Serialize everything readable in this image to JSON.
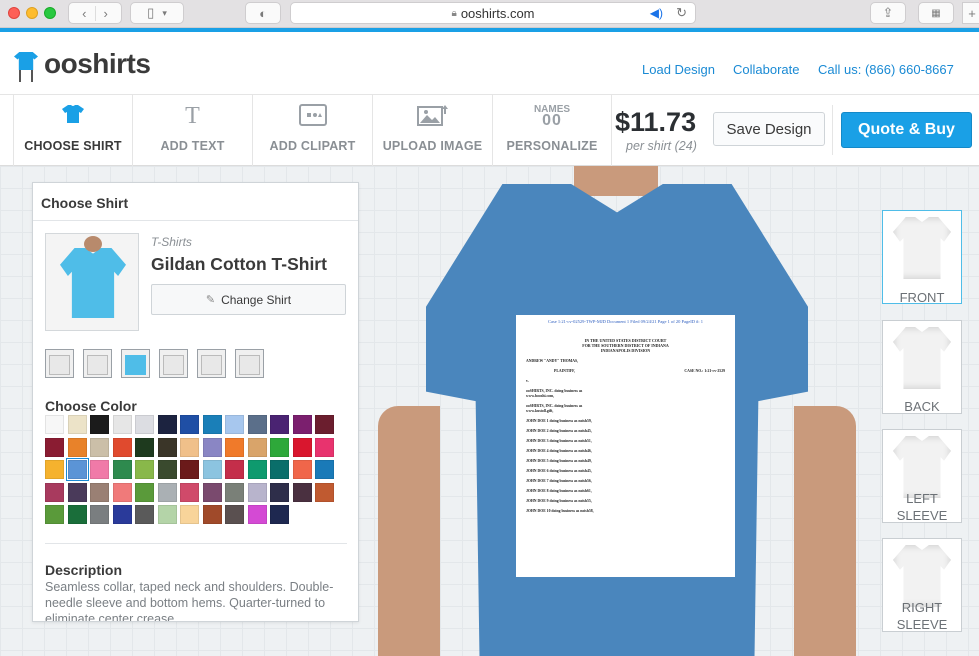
{
  "browser": {
    "url": "ooshirts.com"
  },
  "header": {
    "logo_text": "ooshirts",
    "links": [
      "Load Design",
      "Collaborate",
      "Call us: (866) 660-8667"
    ]
  },
  "toolbar": {
    "tools": [
      {
        "label": "CHOOSE SHIRT",
        "icon": "tshirt-icon"
      },
      {
        "label": "ADD TEXT",
        "icon": "text-icon"
      },
      {
        "label": "ADD CLIPART",
        "icon": "clipart-icon"
      },
      {
        "label": "UPLOAD IMAGE",
        "icon": "upload-image-icon"
      },
      {
        "label": "PERSONALIZE",
        "icon": "names-icon",
        "icon_text_top": "NAMES",
        "icon_text_bottom": "00"
      }
    ],
    "price": "$11.73",
    "per_shirt": "per shirt (24)",
    "save_label": "Save Design",
    "quote_label": "Quote & Buy"
  },
  "panel": {
    "title": "Choose Shirt",
    "category": "T-Shirts",
    "product_name": "Gildan Cotton T-Shirt",
    "change_label": "Change Shirt",
    "choose_color_label": "Choose Color",
    "description_title": "Description",
    "description": "Seamless collar, taped neck and shoulders. Double-needle sleeve and bottom hems. Quarter-turned to eliminate center crease.",
    "colors": [
      "#f7f7f7",
      "#ece3c8",
      "#1b1b1b",
      "#e6e6e6",
      "#dcdde2",
      "#1c2340",
      "#1f4fa5",
      "#1a7fb8",
      "#a7c7ee",
      "#5b6f8a",
      "#4a2372",
      "#7b1f6e",
      "#6b1e2e",
      "#8a1c32",
      "#e8822a",
      "#cbbfa8",
      "#e04a2e",
      "#1e3a1e",
      "#3a3528",
      "#f0c08a",
      "#8a86c4",
      "#f07a2a",
      "#d9a46a",
      "#2ea83a",
      "#d9162e",
      "#e8336e",
      "#f5b22e",
      "#5b94d6",
      "#f07aa8",
      "#2e8a4e",
      "#89b84a",
      "#3a4a2e",
      "#6b1a1a",
      "#8cc4e0",
      "#c42e4a",
      "#0e9a6e",
      "#0a6e6a",
      "#f0664a",
      "#1a7ab8",
      "#a83a5e",
      "#4a3a5a",
      "#9a8074",
      "#f07a7a",
      "#5a9a3a",
      "#aab0b4",
      "#d04a6a",
      "#7a4a6e",
      "#7a8078",
      "#b8b4cc",
      "#2e2e4a",
      "#4a3040",
      "#c05a30",
      "#5a9a3a",
      "#1a6e3a",
      "#7a7e80",
      "#2a3a9a",
      "#5a5a5a",
      "#b4d4a8",
      "#f8d49a",
      "#a04a2a",
      "#5a5050",
      "#d44ad4",
      "#1e2850"
    ],
    "selected_color": "#5b94d6"
  },
  "print_document": {
    "header_line": "Case 1:21-cv-02529-TWP-MJD   Document 1   Filed 09/24/21   Page 1 of 20 PageID #: 1",
    "court_lines": [
      "IN THE UNITED STATES DISTRICT COURT",
      "FOR THE SOUTHERN DISTRICT OF INDIANA",
      "INDIANAPOLIS DIVISION"
    ],
    "plaintiff_line": "ANDREW \"ANDY\" THOMAS,",
    "plaintiff_label": "PLAINTIFF,",
    "case_no": "CASE NO.: 1:21-cv-2529",
    "v": "v.",
    "defendants": [
      "ooSHIRTS, INC. doing business as www.booshi.com,",
      "ooSHIRTS, INC. doing business as www.kustoll.gift,",
      "JOHN DOE 1 doing business as noish59,",
      "JOHN DOE 2 doing business as noish45,",
      "JOHN DOE 3 doing business as noish51,",
      "JOHN DOE 4 doing business as noish46,",
      "JOHN DOE 5 doing business as noish49,",
      "JOHN DOE 6 doing business as noish45,",
      "JOHN DOE 7 doing business as noish56,",
      "JOHN DOE 8 doing business as noish61,",
      "JOHN DOE 9 doing business as noish55,",
      "JOHN DOE 10 doing business as noish58,"
    ]
  },
  "views": [
    {
      "label": "FRONT"
    },
    {
      "label": "BACK"
    },
    {
      "label": "LEFT SLEEVE"
    },
    {
      "label": "RIGHT SLEEVE"
    }
  ]
}
